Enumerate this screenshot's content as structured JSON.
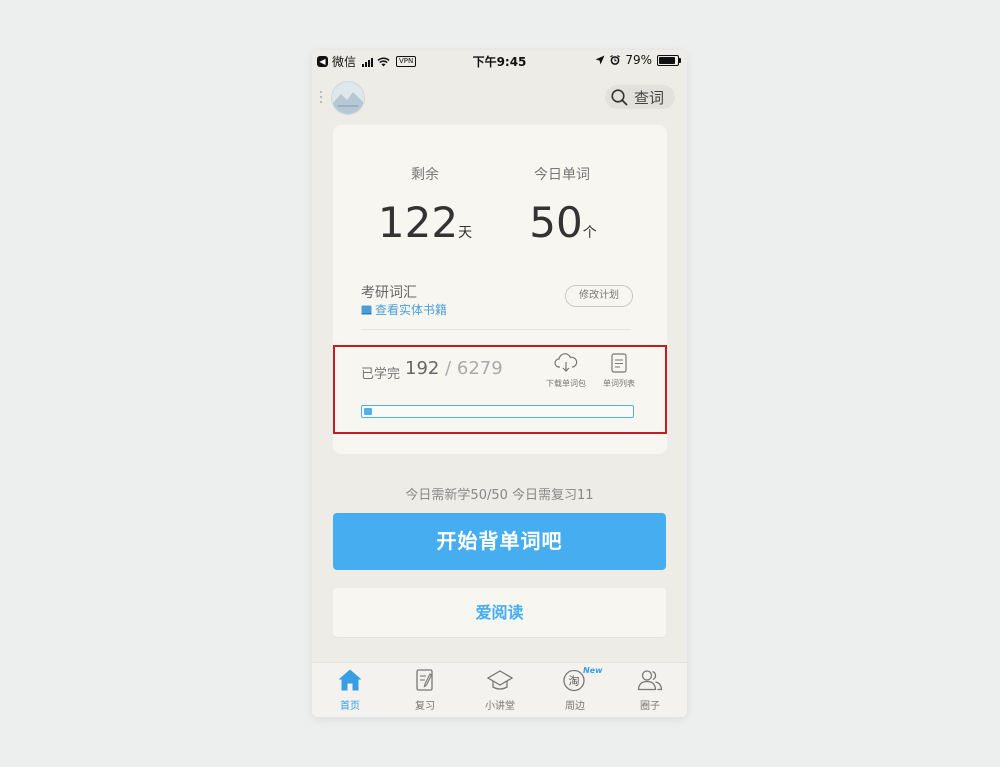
{
  "status_bar": {
    "app_back_label": "微信",
    "vpn_label": "VPN",
    "time": "下午9:45",
    "battery_percent": "79%"
  },
  "header": {
    "search_label": "查词"
  },
  "plan": {
    "remaining_label": "剩余",
    "remaining_value": "122",
    "remaining_unit": "天",
    "today_words_label": "今日单词",
    "today_words_value": "50",
    "today_words_unit": "个",
    "book_title": "考研词汇",
    "book_link": "查看实体书籍",
    "modify_plan_label": "修改计划"
  },
  "progress": {
    "learned_label": "已学完",
    "learned_count": "192",
    "separator": " / ",
    "total_count": "6279",
    "learned_fraction": 0.0306,
    "download_label": "下载单词包",
    "word_list_label": "单词列表"
  },
  "today": {
    "summary": "今日需新学50/50   今日需复习11"
  },
  "actions": {
    "start_label": "开始背单词吧",
    "reading_label": "爱阅读"
  },
  "tabs": [
    {
      "label": "首页",
      "icon": "home-icon",
      "active": true
    },
    {
      "label": "复习",
      "icon": "review-icon",
      "active": false
    },
    {
      "label": "小讲堂",
      "icon": "graduation-cap-icon",
      "active": false
    },
    {
      "label": "周边",
      "icon": "taobao-icon",
      "active": false,
      "badge": "New"
    },
    {
      "label": "圈子",
      "icon": "people-icon",
      "active": false
    }
  ],
  "colors": {
    "accent": "#46aef0",
    "link": "#4b9fd8",
    "highlight_frame": "#c11f1f"
  }
}
